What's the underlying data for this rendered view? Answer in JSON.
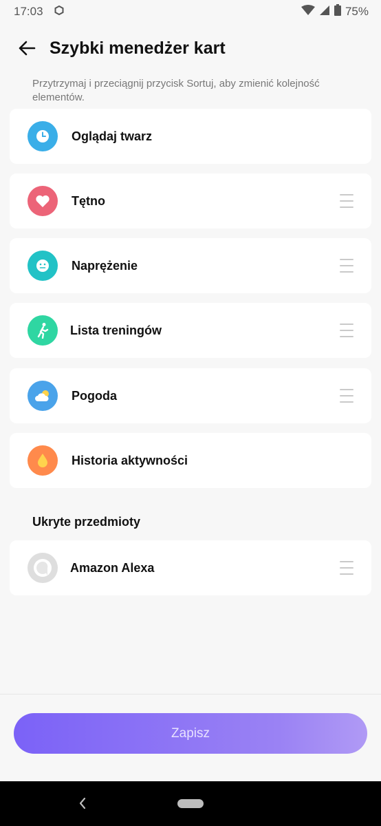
{
  "status_bar": {
    "time": "17:03",
    "battery": "75%"
  },
  "header": {
    "title": "Szybki menedżer kart"
  },
  "hint": "Przytrzymaj i przeciągnij przycisk Sortuj, aby zmienić kolejność elementów.",
  "cards": [
    {
      "label": "Oglądaj twarz",
      "icon": "clock-icon",
      "color": "#3aaee8",
      "draggable": false
    },
    {
      "label": "Tętno",
      "icon": "heart-icon",
      "color": "#ec6478",
      "draggable": true
    },
    {
      "label": "Naprężenie",
      "icon": "face-icon",
      "color": "#22c2c6",
      "draggable": true
    },
    {
      "label": "Lista treningów",
      "icon": "running-icon",
      "color": "#2fd6a2",
      "draggable": true
    },
    {
      "label": "Pogoda",
      "icon": "cloud-sun-icon",
      "color": "#4aa3ea",
      "draggable": true
    },
    {
      "label": "Historia aktywności",
      "icon": "drop-icon",
      "color": "#ff8a4c",
      "draggable": false
    }
  ],
  "hidden_section": {
    "title": "Ukryte przedmioty",
    "items": [
      {
        "label": "Amazon Alexa",
        "icon": "alexa-icon",
        "color": "#d9d9d9",
        "draggable": true
      }
    ]
  },
  "save_button": {
    "label": "Zapisz"
  }
}
